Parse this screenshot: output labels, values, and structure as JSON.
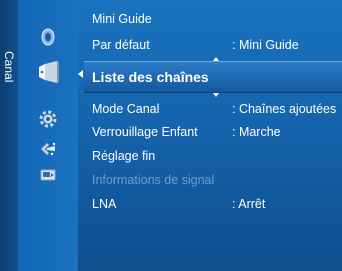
{
  "side_tab": {
    "label": "Canal"
  },
  "icons": [
    {
      "name": "picture-icon"
    },
    {
      "name": "channel-icon"
    },
    {
      "name": "setup-icon"
    },
    {
      "name": "input-icon"
    },
    {
      "name": "application-icon"
    }
  ],
  "menu": {
    "items": [
      {
        "label": "Mini Guide",
        "value": ""
      },
      {
        "label": "Par défaut",
        "value": ": Mini Guide"
      },
      {
        "label": "Liste des chaînes",
        "value": ""
      },
      {
        "label": "Mode Canal",
        "value": ": Chaînes ajoutées"
      },
      {
        "label": "Verrouillage Enfant",
        "value": ": Marche"
      },
      {
        "label": "Réglage fin",
        "value": ""
      },
      {
        "label": "Informations de signal",
        "value": ""
      },
      {
        "label": "LNA",
        "value": ": Arrêt"
      }
    ]
  },
  "colors": {
    "background": "#1564ad",
    "selected": "#1f6cb7",
    "disabled_text": "#6f9ccc"
  }
}
